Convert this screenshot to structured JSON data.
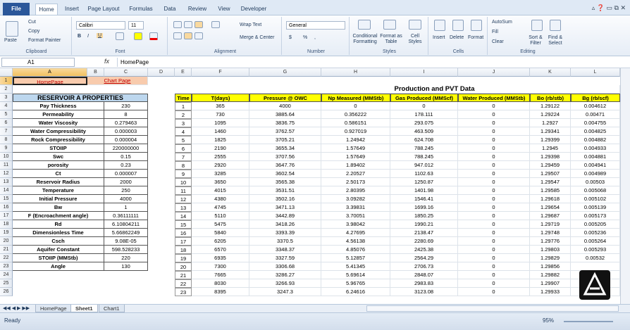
{
  "ribbon_tabs": [
    "File",
    "Home",
    "Insert",
    "Page Layout",
    "Formulas",
    "Data",
    "Review",
    "View",
    "Developer"
  ],
  "ribbon": {
    "clipboard": {
      "paste": "Paste",
      "cut": "Cut",
      "copy": "Copy",
      "format_painter": "Format Painter",
      "label": "Clipboard"
    },
    "font": {
      "name": "Calibri",
      "size": "11",
      "bold": "B",
      "italic": "I",
      "underline": "U",
      "label": "Font"
    },
    "alignment": {
      "wrap": "Wrap Text",
      "merge": "Merge & Center",
      "label": "Alignment"
    },
    "number": {
      "format": "General",
      "currency": "$",
      "percent": "%",
      "comma": ",",
      "label": "Number"
    },
    "styles": {
      "conditional": "Conditional Formatting",
      "table": "Format as Table",
      "cell": "Cell Styles",
      "label": "Styles"
    },
    "cells": {
      "insert": "Insert",
      "delete": "Delete",
      "format": "Format",
      "label": "Cells"
    },
    "editing": {
      "autosum": "AutoSum",
      "fill": "Fill",
      "clear": "Clear",
      "sort": "Sort & Filter",
      "find": "Find & Select",
      "label": "Editing"
    }
  },
  "formula_bar": {
    "name_box": "A1",
    "fx": "fx",
    "content": "HomePage"
  },
  "columns": [
    "A",
    "B",
    "C",
    "D",
    "E",
    "F",
    "G",
    "H",
    "I",
    "J",
    "K",
    "L"
  ],
  "rows": [
    "1",
    "2",
    "3",
    "4",
    "5",
    "6",
    "7",
    "8",
    "9",
    "10",
    "11",
    "12",
    "13",
    "14",
    "15",
    "16",
    "17",
    "18",
    "19",
    "20",
    "21",
    "22",
    "23",
    "24",
    "25",
    "26"
  ],
  "links": {
    "home": "HomePage",
    "chart": "Chart Page"
  },
  "properties_title": "RESERVOIR A PROPERTIES",
  "properties": [
    [
      "Pay Thickness",
      "230"
    ],
    [
      "Permeability",
      "8"
    ],
    [
      "Water Viscosity",
      "0.279463"
    ],
    [
      "Water Compressibility",
      "0.000003"
    ],
    [
      "Rock Compressibility",
      "0.000004"
    ],
    [
      "STOIIP",
      "220000000"
    ],
    [
      "Swc",
      "0.15"
    ],
    [
      "porosity",
      "0.23"
    ],
    [
      "Ct",
      "0.000007"
    ],
    [
      "Reservoir Radius",
      "2000"
    ],
    [
      "Temperature",
      "250"
    ],
    [
      "Initial Pressure",
      "4000"
    ],
    [
      "Bw",
      "1"
    ],
    [
      "F (Encroachment angle)",
      "0.36111111"
    ],
    [
      "Rd",
      "6.10804211"
    ],
    [
      "Dimensionless Time",
      "5.66862249"
    ],
    [
      "Csch",
      "9.08E-05"
    ],
    [
      "Aquifer Constant",
      "598.528233"
    ],
    [
      "STOIIP (MMStb)",
      "220"
    ],
    [
      "Angle",
      "130"
    ]
  ],
  "pvt_title": "Production and PVT Data",
  "pvt_headers": [
    "Time",
    "T(days)",
    "Pressure @ OWC",
    "Np Measured (MMStb)",
    "Gas Produced (MMScf)",
    "Water Produced  (MMStb)",
    "Bo (rb/stb)",
    "Bg (rb/scf)"
  ],
  "pvt_rows": [
    [
      "1",
      "365",
      "4000",
      "0",
      "0",
      "0",
      "1.29122",
      "0.004612"
    ],
    [
      "2",
      "730",
      "3885.64",
      "0.356222",
      "178.111",
      "0",
      "1.29224",
      "0.00471"
    ],
    [
      "3",
      "1095",
      "3836.75",
      "0.586151",
      "293.075",
      "0",
      "1.2927",
      "0.004755"
    ],
    [
      "4",
      "1460",
      "3762.57",
      "0.927019",
      "463.509",
      "0",
      "1.29341",
      "0.004825"
    ],
    [
      "5",
      "1825",
      "3705.21",
      "1.24942",
      "624.708",
      "0",
      "1.29399",
      "0.004882"
    ],
    [
      "6",
      "2190",
      "3655.34",
      "1.57649",
      "788.245",
      "0",
      "1.2945",
      "0.004933"
    ],
    [
      "7",
      "2555",
      "3707.56",
      "1.57649",
      "788.245",
      "0",
      "1.29398",
      "0.004881"
    ],
    [
      "8",
      "2920",
      "3647.76",
      "1.89402",
      "947.012",
      "0",
      "1.29459",
      "0.004941"
    ],
    [
      "9",
      "3285",
      "3602.54",
      "2.20527",
      "1102.63",
      "0",
      "1.29507",
      "0.004989"
    ],
    [
      "10",
      "3650",
      "3565.38",
      "2.50173",
      "1250.87",
      "0",
      "1.29547",
      "0.00503"
    ],
    [
      "11",
      "4015",
      "3531.51",
      "2.80395",
      "1401.98",
      "0",
      "1.29585",
      "0.005068"
    ],
    [
      "12",
      "4380",
      "3502.16",
      "3.09282",
      "1546.41",
      "0",
      "1.29618",
      "0.005102"
    ],
    [
      "13",
      "4745",
      "3471.13",
      "3.39831",
      "1699.16",
      "0",
      "1.29654",
      "0.005139"
    ],
    [
      "14",
      "5110",
      "3442.89",
      "3.70051",
      "1850.25",
      "0",
      "1.29687",
      "0.005173"
    ],
    [
      "15",
      "5475",
      "3418.26",
      "3.98042",
      "1990.21",
      "0",
      "1.29719",
      "0.005205"
    ],
    [
      "16",
      "5840",
      "3393.39",
      "4.27695",
      "2138.47",
      "0",
      "1.29748",
      "0.005236"
    ],
    [
      "17",
      "6205",
      "3370.5",
      "4.56138",
      "2280.69",
      "0",
      "1.29776",
      "0.005264"
    ],
    [
      "18",
      "6570",
      "3348.37",
      "4.85076",
      "2425.38",
      "0",
      "1.29803",
      "0.005293"
    ],
    [
      "19",
      "6935",
      "3327.59",
      "5.12857",
      "2564.29",
      "0",
      "1.29829",
      "0.00532"
    ],
    [
      "20",
      "7300",
      "3306.68",
      "5.41345",
      "2706.73",
      "0",
      "1.29856",
      ""
    ],
    [
      "21",
      "7665",
      "3286.27",
      "5.69614",
      "2848.07",
      "0",
      "1.29882",
      ""
    ],
    [
      "22",
      "8030",
      "3266.93",
      "5.96765",
      "2983.83",
      "0",
      "1.29907",
      ""
    ],
    [
      "23",
      "8395",
      "3247.3",
      "6.24616",
      "3123.08",
      "0",
      "1.29933",
      ""
    ]
  ],
  "sheets": [
    "HomePage",
    "Sheet1",
    "Chart1"
  ],
  "status": {
    "ready": "Ready",
    "zoom": "95%"
  }
}
